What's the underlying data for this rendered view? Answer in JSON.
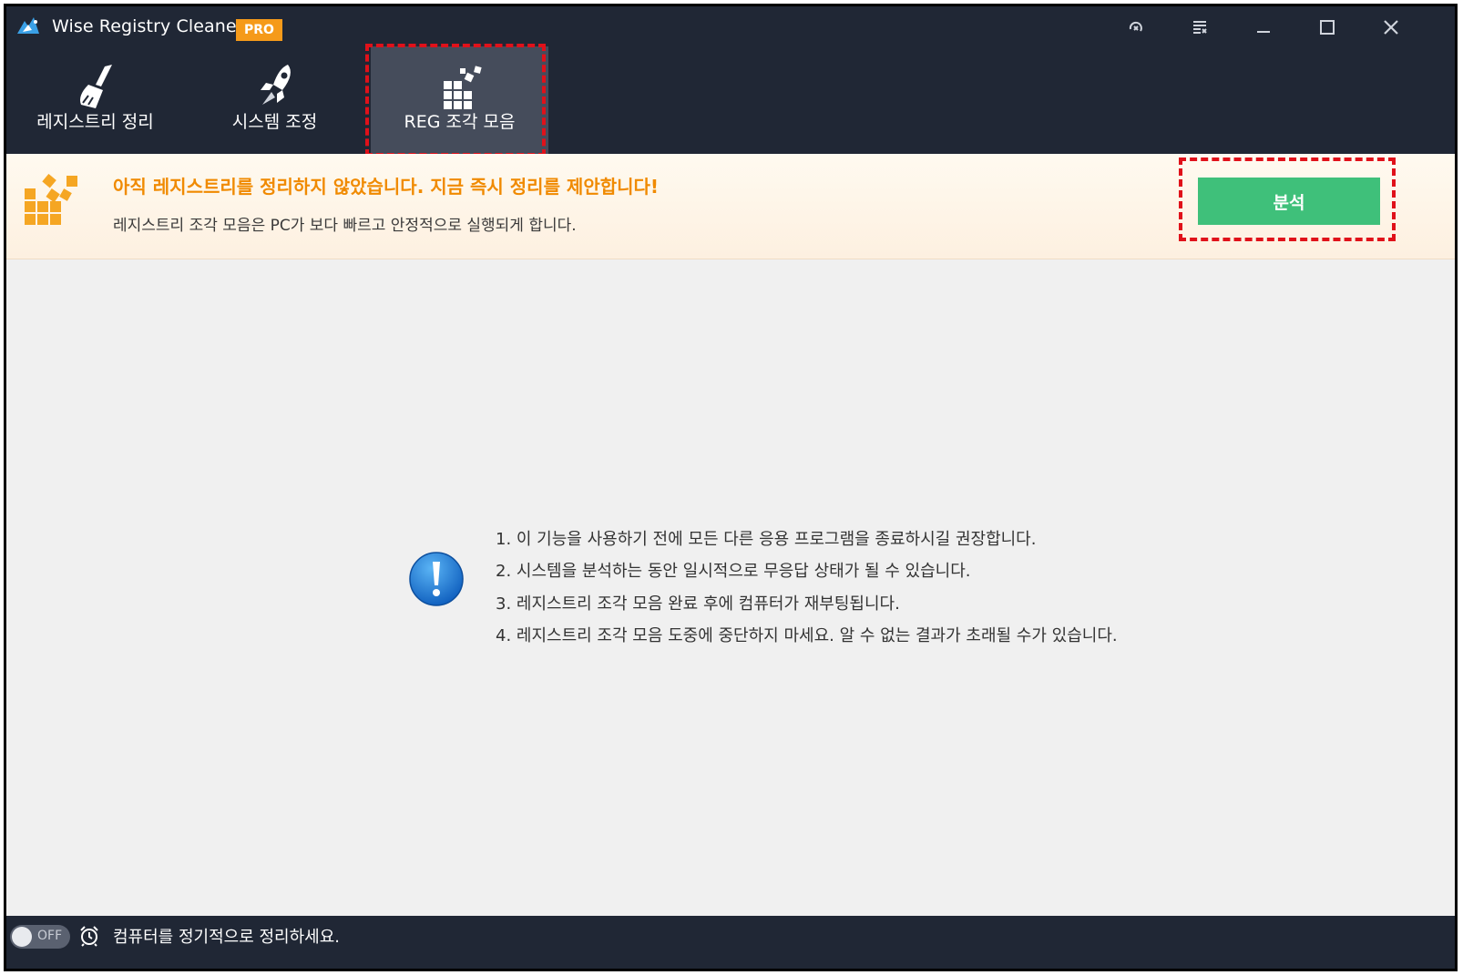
{
  "window": {
    "title": "Wise Registry Cleaner X",
    "badge": "PRO"
  },
  "nav": {
    "tabs": [
      {
        "label": "레지스트리 정리",
        "icon": "broom-icon"
      },
      {
        "label": "시스템 조정",
        "icon": "rocket-icon"
      },
      {
        "label": "REG 조각 모음",
        "icon": "defrag-blocks-icon",
        "selected": true
      }
    ]
  },
  "banner": {
    "heading": "아직 레지스트리를 정리하지 않았습니다. 지금 즉시 정리를 제안합니다!",
    "subtext": "레지스트리 조각 모음은 PC가 보다 빠르고 안정적으로 실행되게 합니다.",
    "button_label": "분석"
  },
  "notes": [
    "1. 이 기능을 사용하기 전에 모든 다른 응용 프로그램을 종료하시길 권장합니다.",
    "2. 시스템을 분석하는 동안 일시적으로 무응답 상태가 될 수 있습니다.",
    "3. 레지스트리 조각 모음 완료 후에 컴퓨터가 재부팅됩니다.",
    "4. 레지스트리 조각 모음 도중에 중단하지 마세요. 알 수 없는 결과가 초래될 수가 있습니다."
  ],
  "footer": {
    "toggle_label": "OFF",
    "text": "컴퓨터를 정기적으로 정리하세요."
  },
  "colors": {
    "titlebar": "#202735",
    "selected_tab": "#454c5b",
    "accent_orange": "#f08a00",
    "button_green": "#3fc07a",
    "highlight_red": "#e0111a"
  }
}
